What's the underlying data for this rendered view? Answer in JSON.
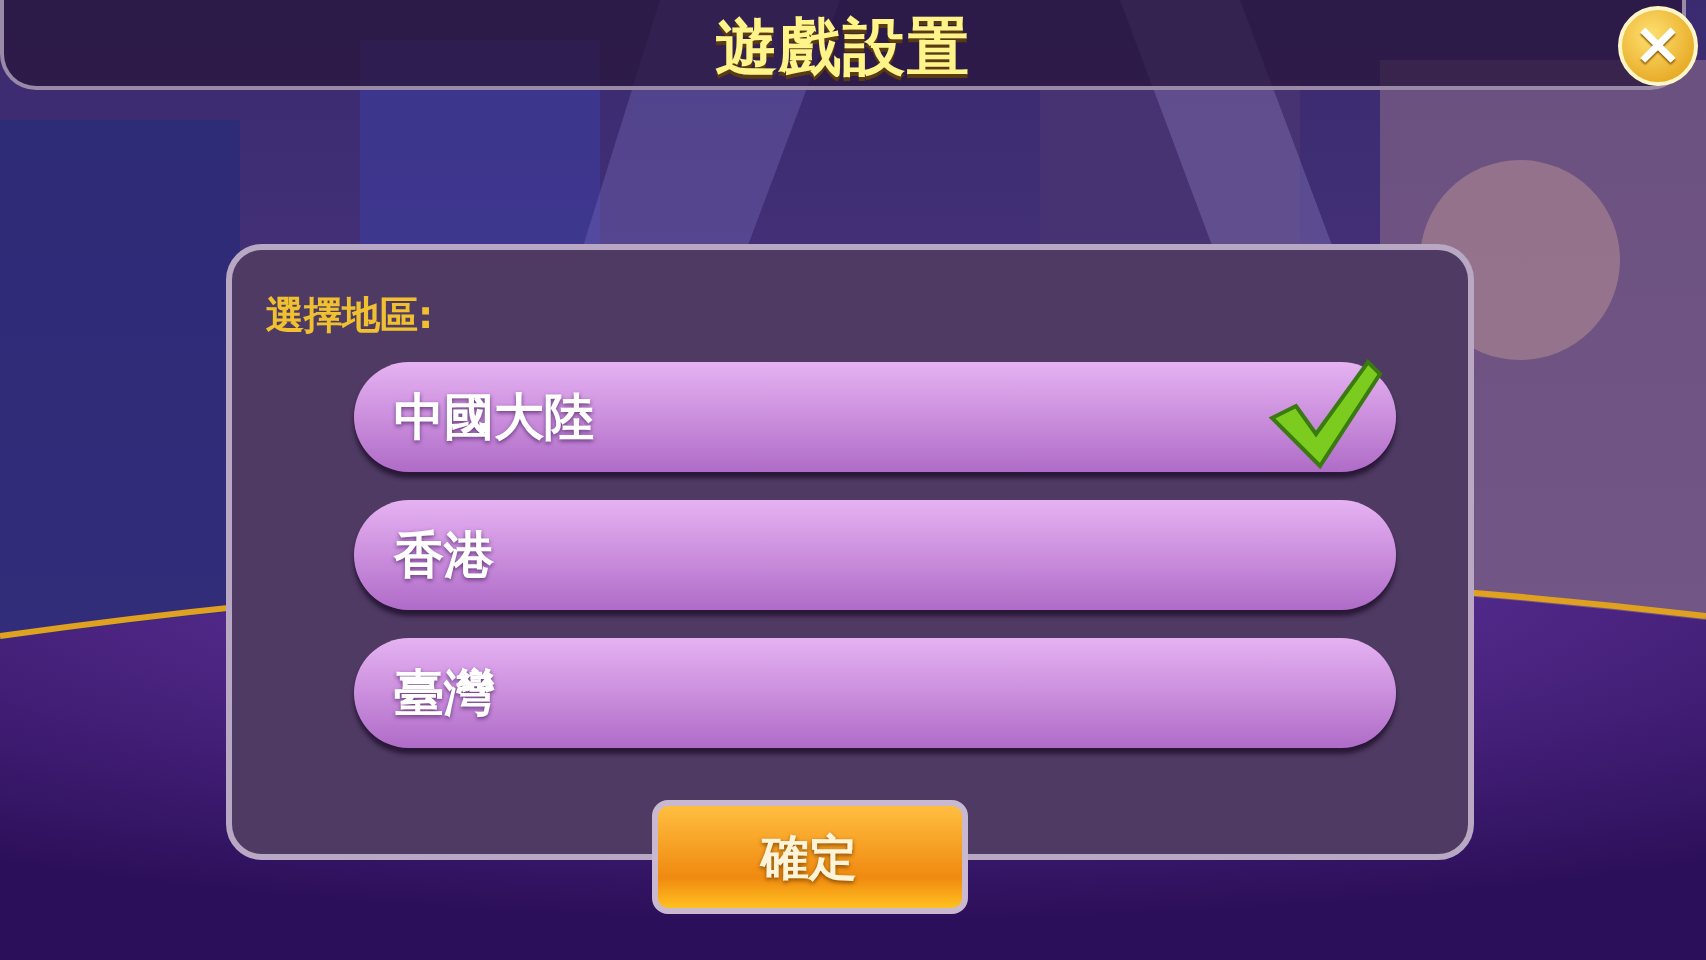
{
  "header": {
    "title": "遊戲設置",
    "close_label": "×"
  },
  "region_panel": {
    "label": "選擇地區:",
    "options": [
      {
        "label": "中國大陸",
        "selected": true
      },
      {
        "label": "香港",
        "selected": false
      },
      {
        "label": "臺灣",
        "selected": false
      }
    ],
    "confirm_button": "確定"
  }
}
